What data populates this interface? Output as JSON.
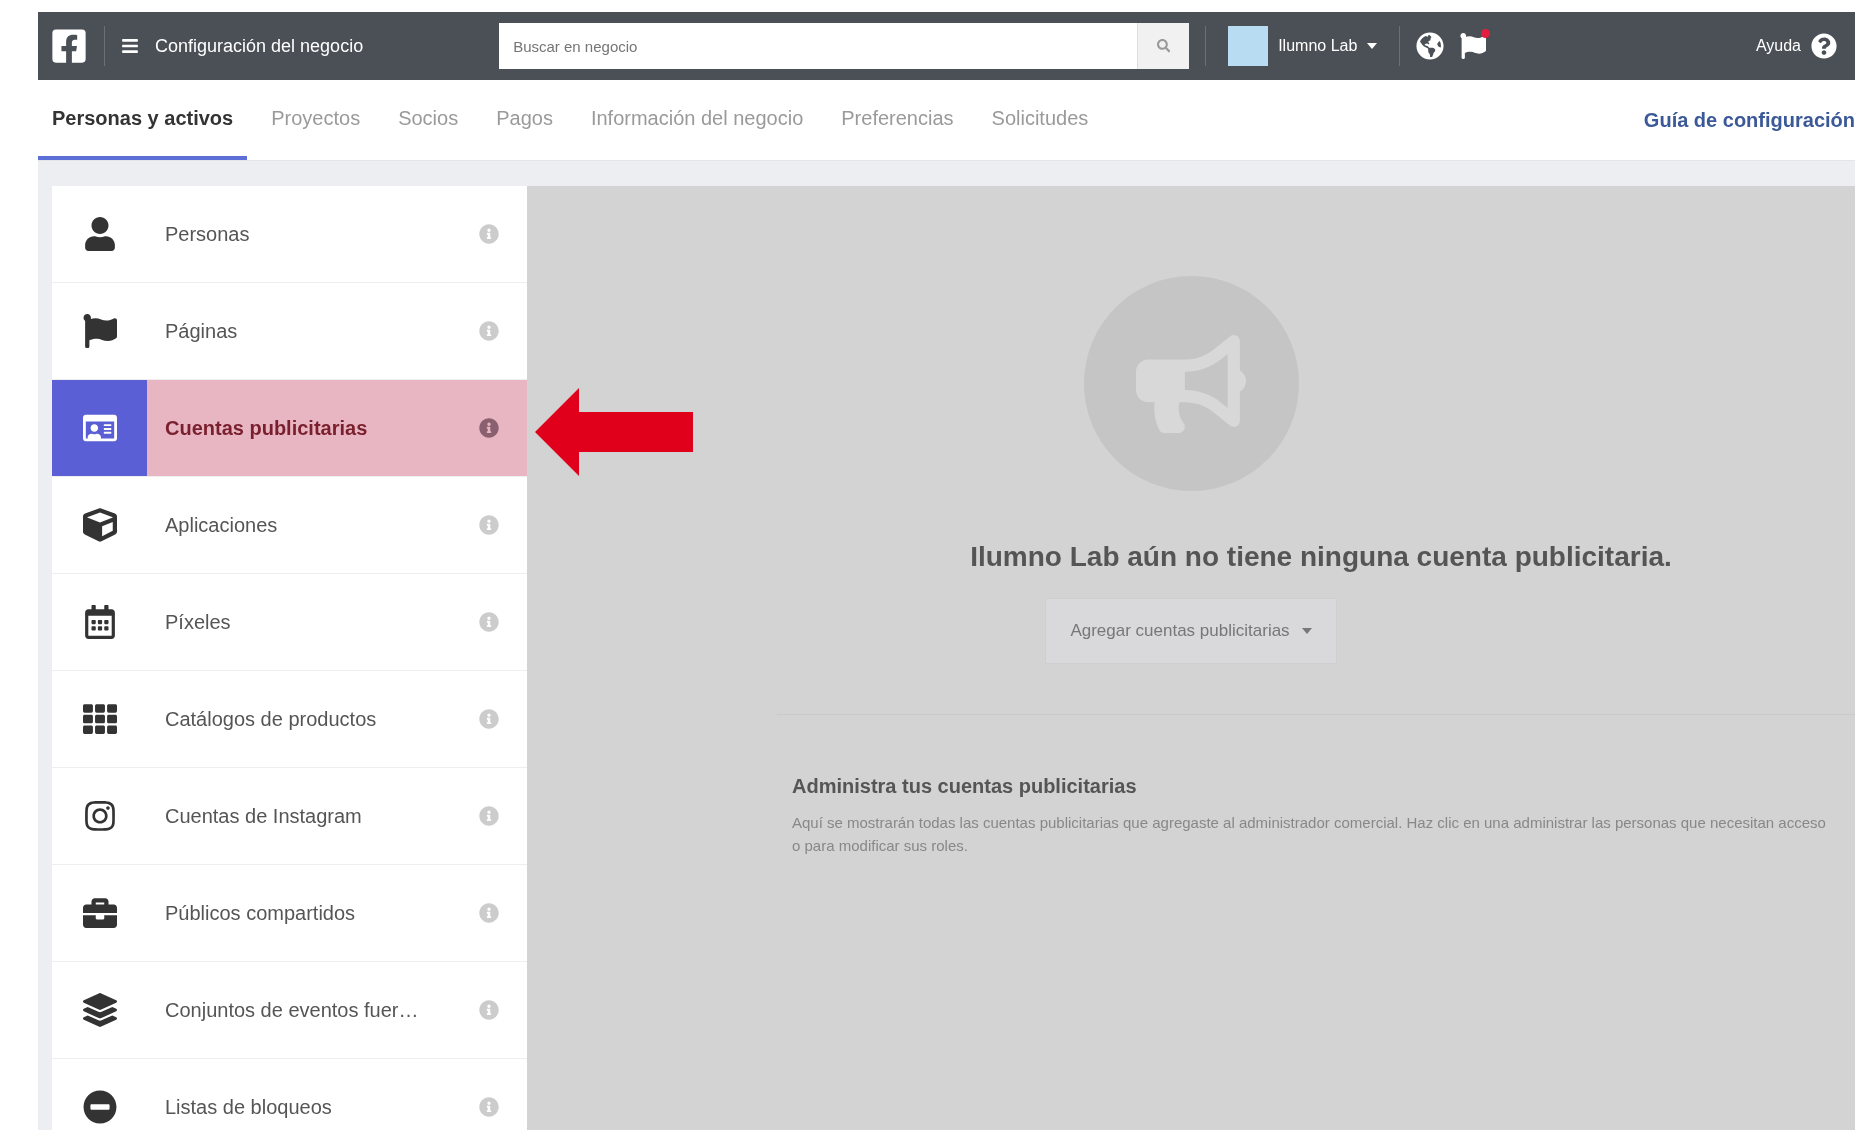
{
  "topbar": {
    "title": "Configuración del negocio",
    "search": {
      "placeholder": "Buscar en negocio"
    },
    "business": "Ilumno Lab",
    "help": "Ayuda"
  },
  "tabs": [
    {
      "label": "Personas y activos",
      "selected": true
    },
    {
      "label": "Proyectos",
      "selected": false
    },
    {
      "label": "Socios",
      "selected": false
    },
    {
      "label": "Pagos",
      "selected": false
    },
    {
      "label": "Información del negocio",
      "selected": false
    },
    {
      "label": "Preferencias",
      "selected": false
    },
    {
      "label": "Solicitudes",
      "selected": false
    }
  ],
  "setup_link": "Guía de configuración",
  "sidebar": {
    "items": [
      {
        "label": "Personas",
        "selected": false
      },
      {
        "label": "Páginas",
        "selected": false
      },
      {
        "label": "Cuentas publicitarias",
        "selected": true
      },
      {
        "label": "Aplicaciones",
        "selected": false
      },
      {
        "label": "Píxeles",
        "selected": false
      },
      {
        "label": "Catálogos de productos",
        "selected": false
      },
      {
        "label": "Cuentas de Instagram",
        "selected": false
      },
      {
        "label": "Públicos compartidos",
        "selected": false
      },
      {
        "label": "Conjuntos de eventos fuer…",
        "selected": false
      },
      {
        "label": "Listas de bloqueos",
        "selected": false
      }
    ]
  },
  "main": {
    "heading": "Ilumno Lab aún no tiene ninguna cuenta publicitaria.",
    "add_button": "Agregar cuentas publicitarias",
    "section": {
      "title": "Administra tus cuentas publicitarias",
      "text": "Aquí se mostrarán todas las cuentas publicitarias que agregaste al administrador comercial. Haz clic en una administrar las personas que necesitan acceso o para modificar sus roles."
    }
  }
}
